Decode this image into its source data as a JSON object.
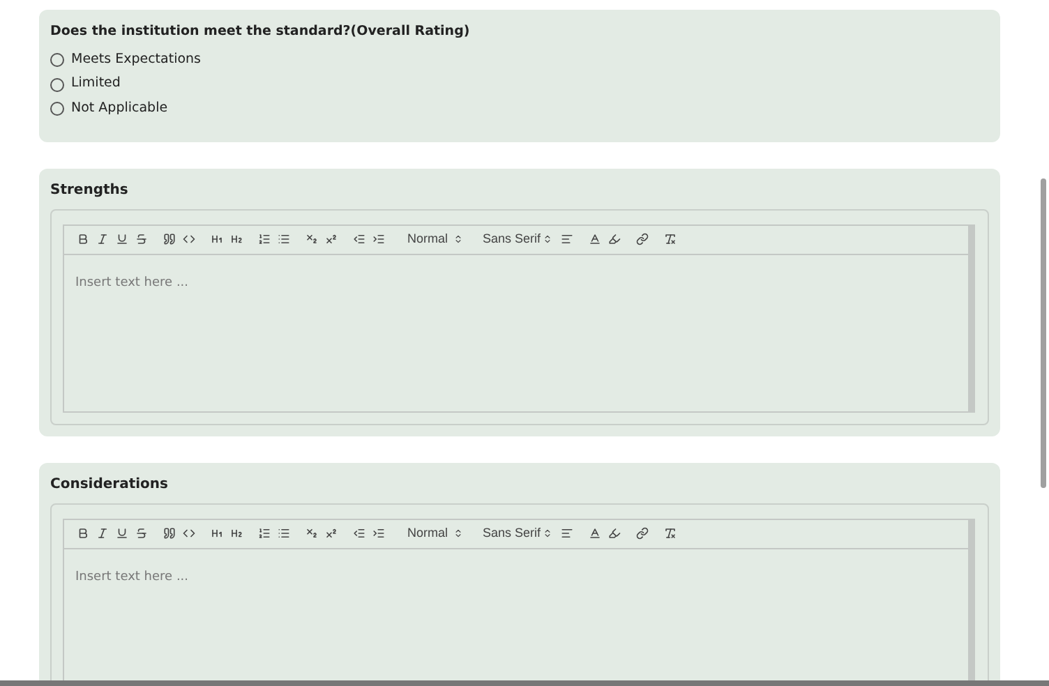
{
  "rating": {
    "question": "Does the institution meet the standard?(Overall Rating)",
    "options": [
      {
        "label": "Meets Expectations",
        "selected": false
      },
      {
        "label": "Limited",
        "selected": false
      },
      {
        "label": "Not Applicable",
        "selected": false
      }
    ]
  },
  "editors": [
    {
      "title": "Strengths",
      "header_picker": "Normal",
      "font_picker": "Sans Serif",
      "placeholder": "Insert text here ..."
    },
    {
      "title": "Considerations",
      "header_picker": "Normal",
      "font_picker": "Sans Serif",
      "placeholder": "Insert text here ..."
    }
  ]
}
